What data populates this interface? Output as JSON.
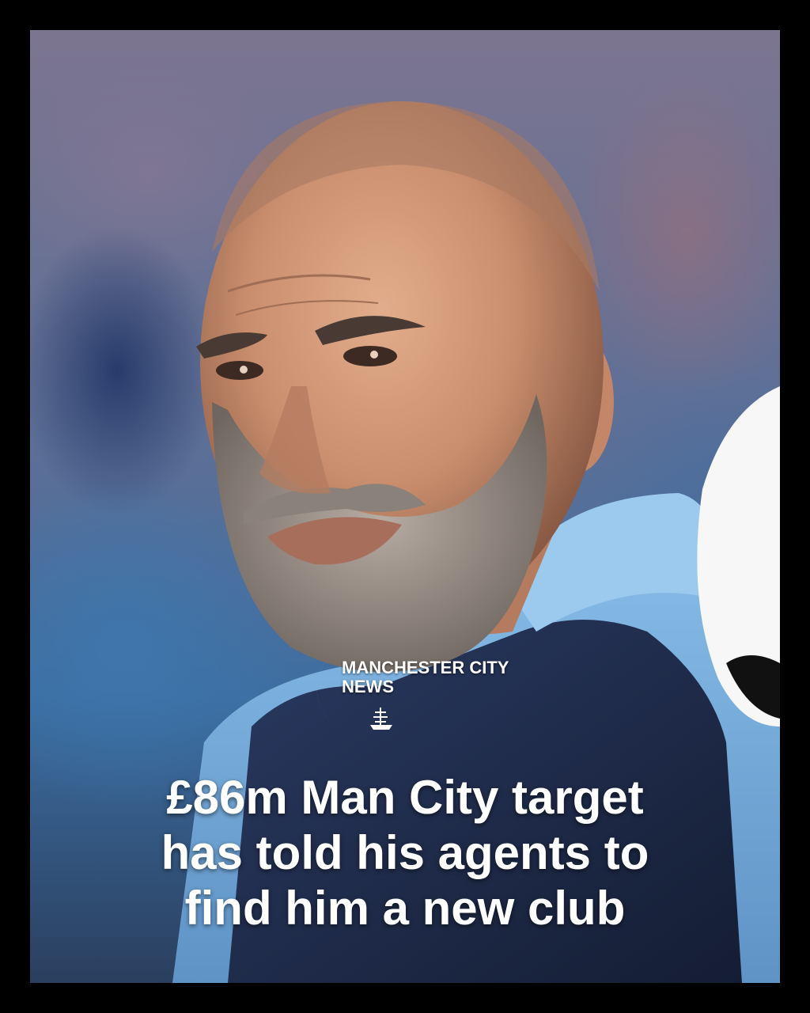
{
  "logo": {
    "line1": "MANCHESTER CITY",
    "line2": "NEWS"
  },
  "headline": {
    "line1": "£86m Man City target",
    "line2": "has told his agents to",
    "line3": "find him a new club"
  },
  "colors": {
    "border": "#000000",
    "jacket_light": "#7db3e0",
    "jacket_dark": "#1c2a4a",
    "text": "#ffffff"
  }
}
